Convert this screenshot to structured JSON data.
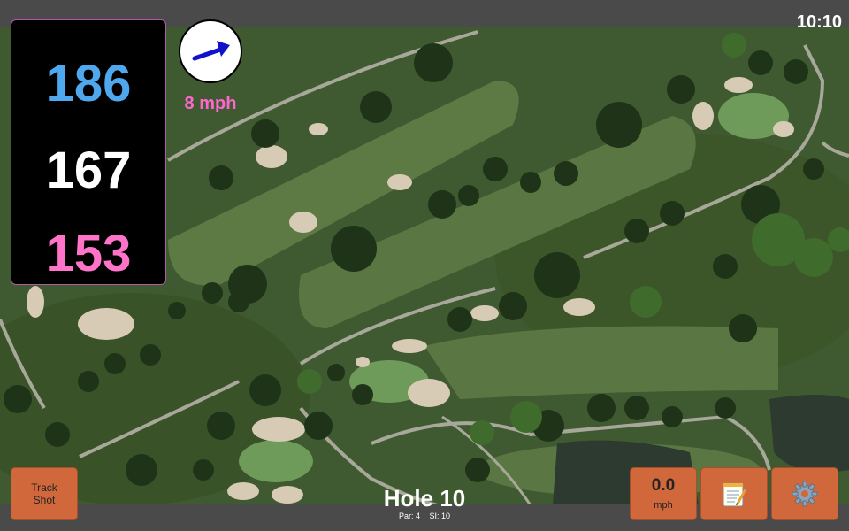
{
  "status": {
    "time": "10:10"
  },
  "distances": {
    "back": "186",
    "middle": "167",
    "front": "153"
  },
  "wind": {
    "speed": "8 mph",
    "direction_icon": "wind-arrow-icon"
  },
  "hole": {
    "title": "Hole 10",
    "par": "Par: 4",
    "stroke_index": "SI: 10"
  },
  "buttons": {
    "track_shot": "Track\nShot",
    "speed_value": "0.0",
    "speed_unit": "mph",
    "notes_icon": "notepad-icon",
    "settings_icon": "gear-icon"
  },
  "colors": {
    "back": "#4fa8ee",
    "middle": "#ffffff",
    "front": "#ff73c8",
    "button": "#d0683b",
    "wind_text": "#ff66d0"
  }
}
